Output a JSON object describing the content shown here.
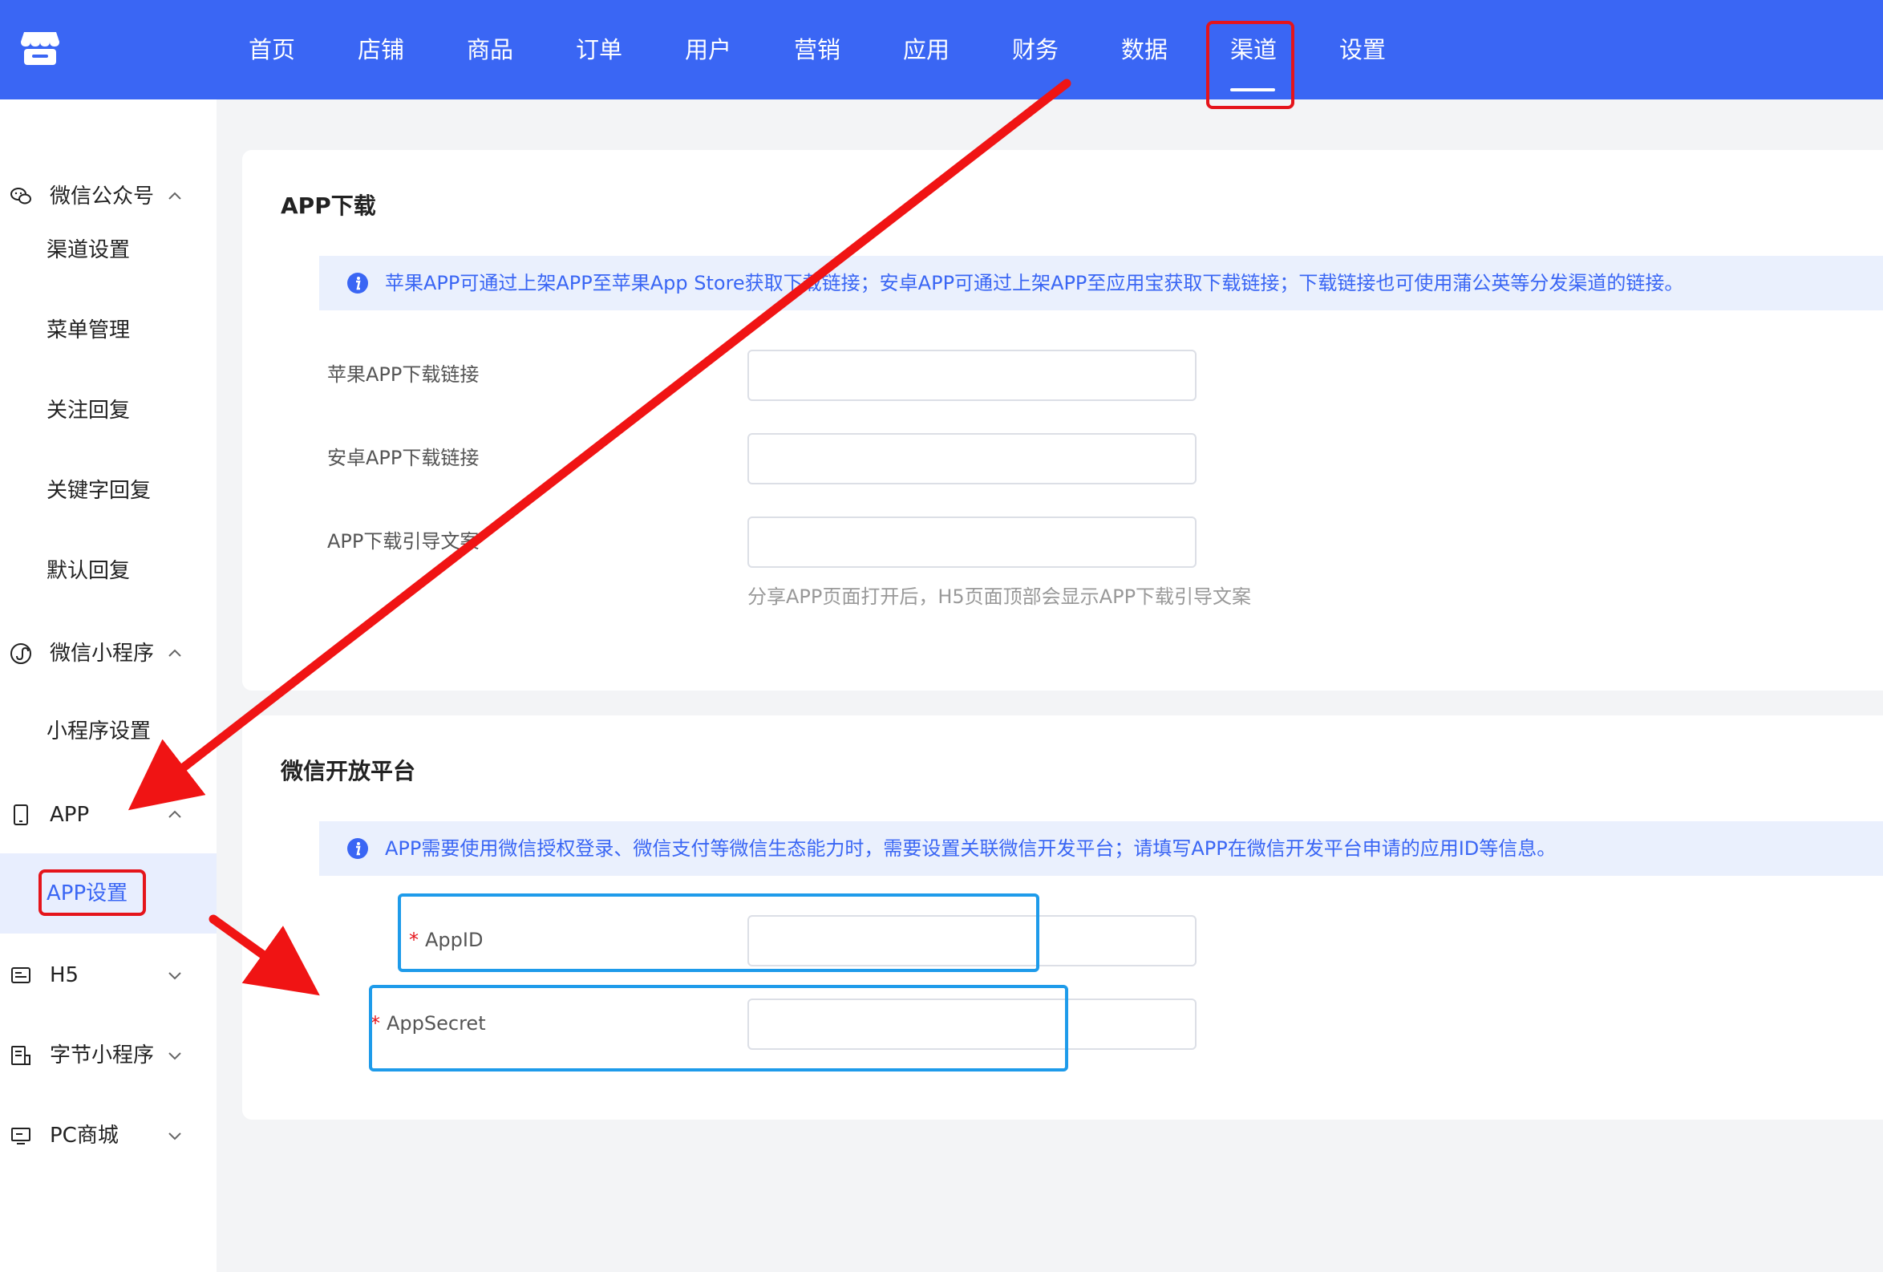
{
  "nav": {
    "items": [
      "首页",
      "店铺",
      "商品",
      "订单",
      "用户",
      "营销",
      "应用",
      "财务",
      "数据",
      "渠道",
      "设置"
    ],
    "active": "渠道"
  },
  "sidebar": {
    "wechat_mp": {
      "label": "微信公众号",
      "items": [
        "渠道设置",
        "菜单管理",
        "关注回复",
        "关键字回复",
        "默认回复"
      ]
    },
    "wechat_mini": {
      "label": "微信小程序",
      "items": [
        "小程序设置"
      ]
    },
    "app": {
      "label": "APP",
      "items": [
        "APP设置"
      ],
      "active_item": "APP设置"
    },
    "h5": {
      "label": "H5"
    },
    "bytedance": {
      "label": "字节小程序"
    },
    "pc": {
      "label": "PC商城"
    }
  },
  "app_download": {
    "title": "APP下载",
    "notice": "苹果APP可通过上架APP至苹果App Store获取下载链接；安卓APP可通过上架APP至应用宝获取下载链接；下载链接也可使用蒲公英等分发渠道的链接。",
    "fields": [
      {
        "label": "苹果APP下载链接",
        "value": ""
      },
      {
        "label": "安卓APP下载链接",
        "value": ""
      },
      {
        "label": "APP下载引导文案",
        "value": ""
      }
    ],
    "hint": "分享APP页面打开后，H5页面顶部会显示APP下载引导文案"
  },
  "wechat_open": {
    "title": "微信开放平台",
    "notice": "APP需要使用微信授权登录、微信支付等微信生态能力时，需要设置关联微信开发平台；请填写APP在微信开发平台申请的应用ID等信息。",
    "required_mark": "*",
    "fields": [
      {
        "label": "AppID",
        "value": ""
      },
      {
        "label": "AppSecret",
        "value": ""
      }
    ]
  },
  "colors": {
    "primary": "#3a66f4",
    "highlight_red": "#e5141b",
    "highlight_blue": "#1e9bea",
    "annotation_arrow": "#f01414"
  }
}
